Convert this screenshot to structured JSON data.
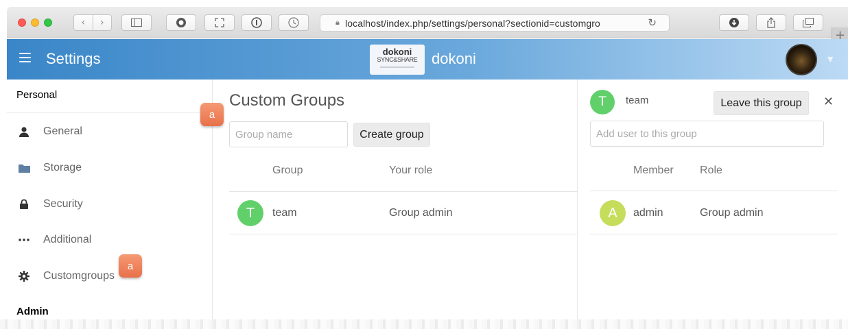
{
  "browser": {
    "url": "localhost/index.php/settings/personal?sectionid=customgro",
    "new_tab": "+"
  },
  "header": {
    "title": "Settings",
    "logo_line1": "dokoni",
    "logo_line2": "SYNC&SHARE",
    "brand": "dokoni",
    "colors": {
      "gradient_start": "#3a86c8",
      "gradient_end": "#bcdaf4"
    }
  },
  "sidebar": {
    "personal_heading": "Personal",
    "admin_heading": "Admin",
    "items": [
      {
        "label": "General",
        "icon": "person-icon"
      },
      {
        "label": "Storage",
        "icon": "folder-icon"
      },
      {
        "label": "Security",
        "icon": "lock-icon"
      },
      {
        "label": "Additional",
        "icon": "more-icon"
      },
      {
        "label": "Customgroups",
        "icon": "gear-icon"
      }
    ]
  },
  "main": {
    "title": "Custom Groups",
    "group_name_placeholder": "Group name",
    "create_button": "Create group",
    "columns": [
      "Group",
      "Your role"
    ],
    "rows": [
      {
        "initial": "T",
        "name": "team",
        "role": "Group admin",
        "color": "#61d06b"
      }
    ]
  },
  "detail": {
    "initial": "T",
    "group_name": "team",
    "leave_button": "Leave this group",
    "close_symbol": "✕",
    "add_user_placeholder": "Add user to this group",
    "columns": [
      "Member",
      "Role"
    ],
    "rows": [
      {
        "initial": "A",
        "name": "admin",
        "role": "Group admin",
        "color": "#c6dd5b"
      }
    ]
  },
  "callouts": [
    {
      "label": "a"
    },
    {
      "label": "a"
    }
  ]
}
